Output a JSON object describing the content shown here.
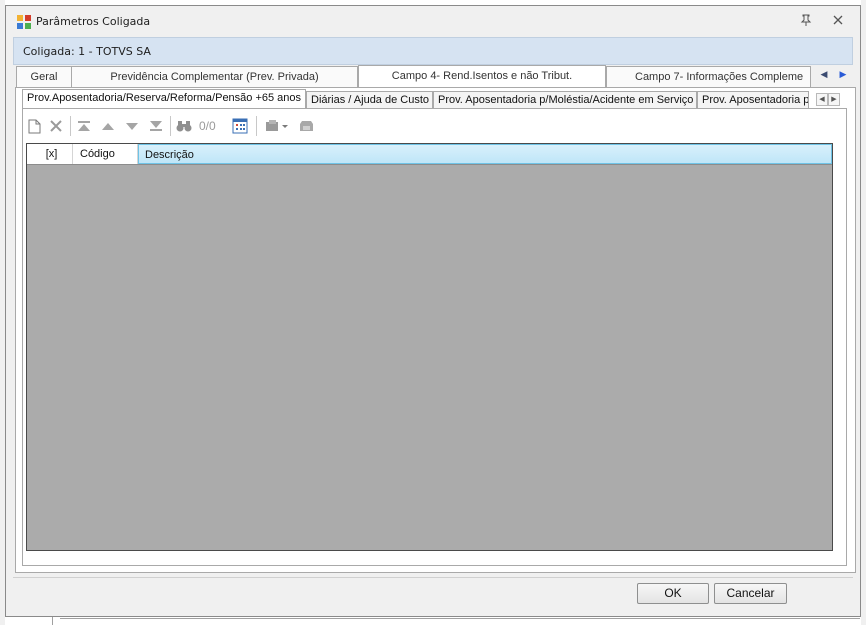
{
  "window": {
    "title": "Parâmetros Coligada",
    "pin_icon": "pin-icon",
    "close_icon": "close-icon"
  },
  "coligada": {
    "label": "Coligada: 1 - TOTVS SA"
  },
  "outer_tabs": [
    {
      "label": "Geral"
    },
    {
      "label": "Previdência Complementar (Prev. Privada)"
    },
    {
      "label": "Campo 4- Rend.Isentos e não Tribut."
    },
    {
      "label": "Campo 7- Informações Compleme"
    }
  ],
  "inner_tabs": [
    {
      "label": "Prov.Aposentadoria/Reserva/Reforma/Pensão +65 anos"
    },
    {
      "label": "Diárias / Ajuda de Custo"
    },
    {
      "label": "Prov. Aposentadoria p/Moléstia/Acidente em Serviço"
    },
    {
      "label": "Prov. Aposentadoria p"
    }
  ],
  "toolbar": {
    "pager_text": "0/0"
  },
  "grid": {
    "columns": [
      {
        "label": "[x]"
      },
      {
        "label": "Código"
      },
      {
        "label": "Descrição"
      }
    ],
    "rows": []
  },
  "buttons": {
    "ok": "OK",
    "cancel": "Cancelar"
  },
  "colors": {
    "coligada_bar": "#d6e3f2",
    "grid_bg": "#ababab",
    "header_selected": "#bfe6f8"
  }
}
